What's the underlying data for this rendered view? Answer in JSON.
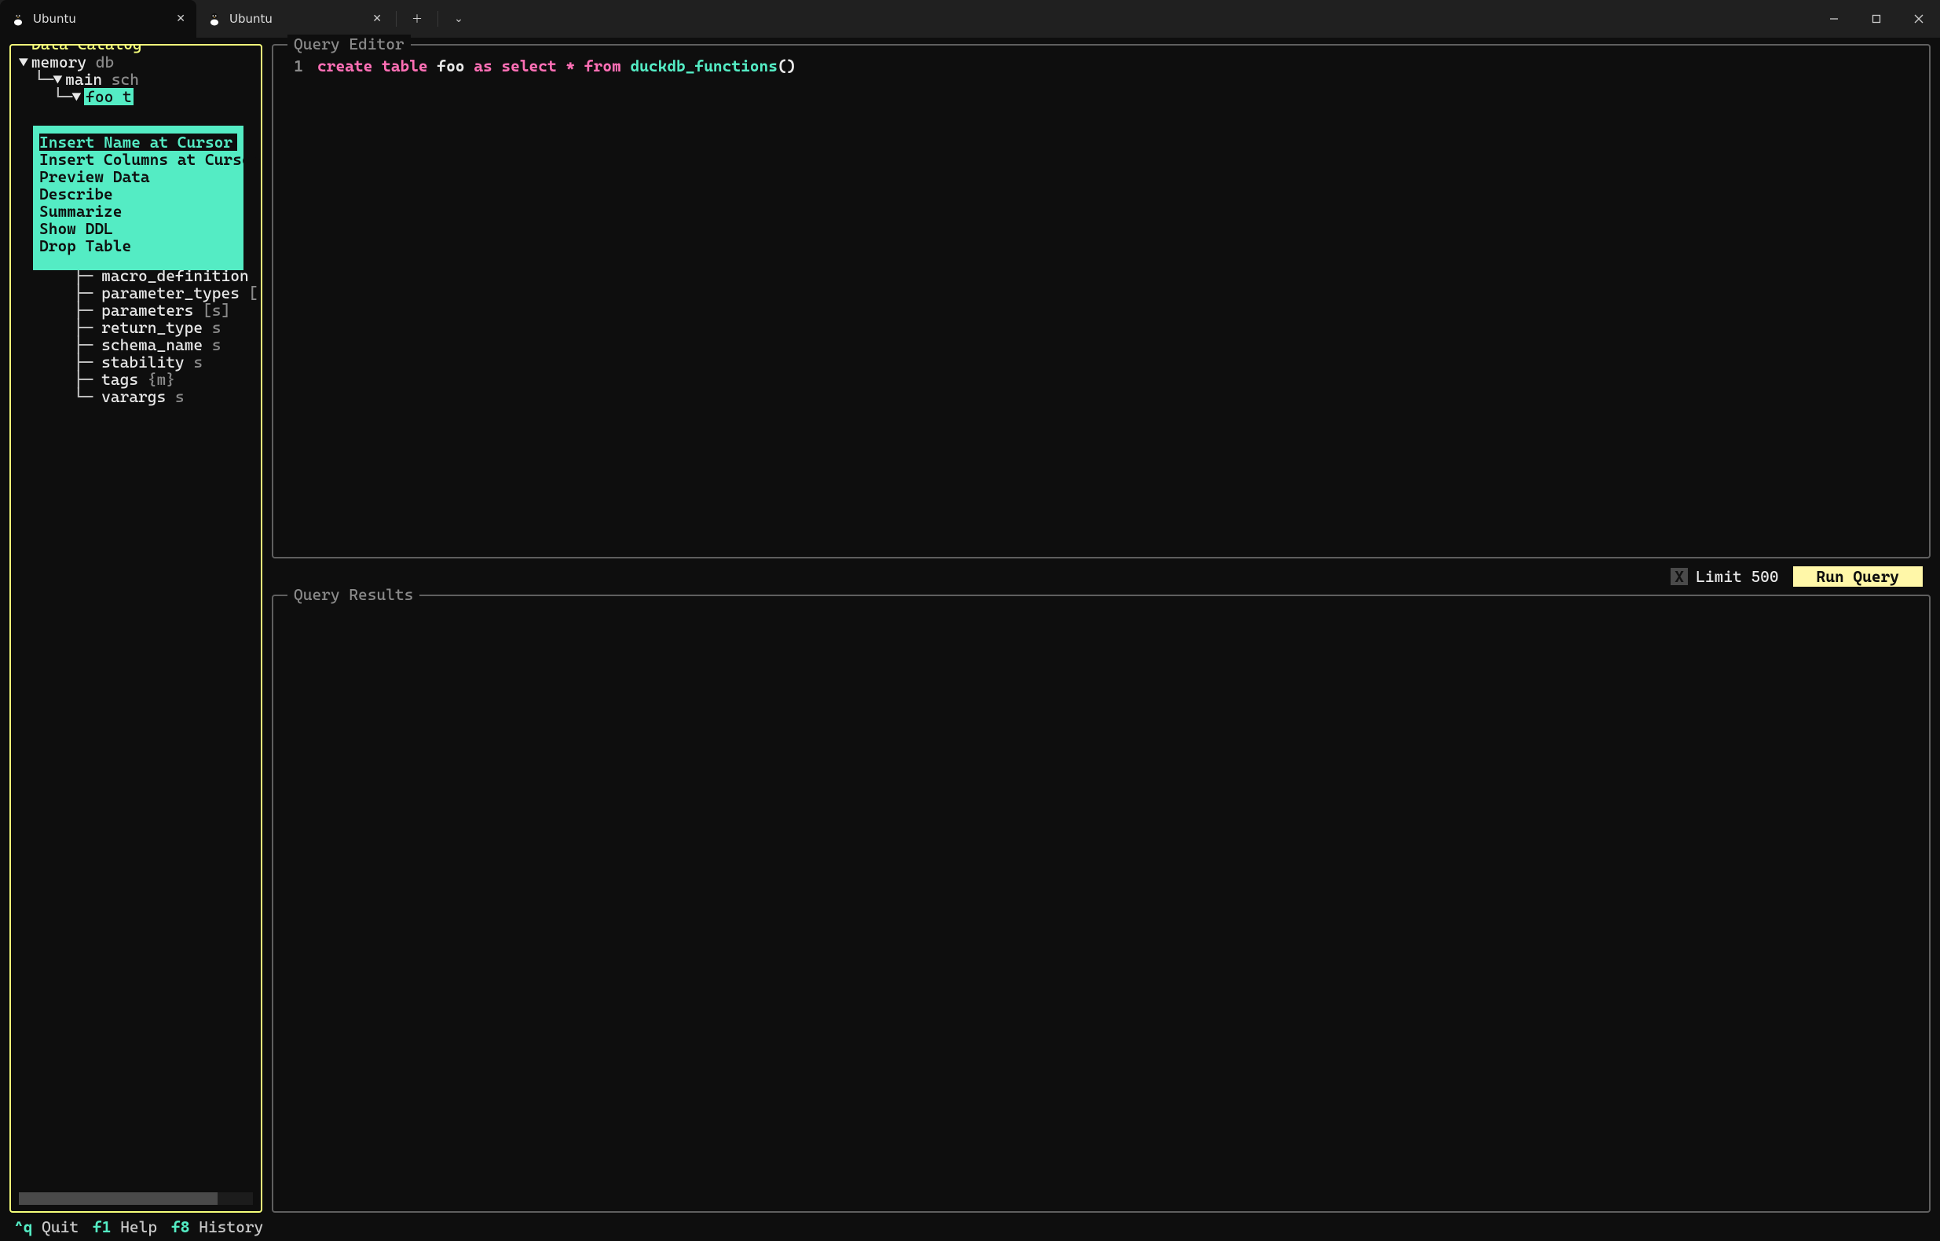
{
  "titlebar": {
    "tabs": [
      {
        "label": "Ubuntu",
        "active": true
      },
      {
        "label": "Ubuntu",
        "active": false
      }
    ]
  },
  "catalog": {
    "title": "Data Catalog",
    "db": {
      "name": "memory",
      "type": "db"
    },
    "schema": {
      "name": "main",
      "type": "sch"
    },
    "table": {
      "name": "foo",
      "type": "t"
    },
    "columns": [
      {
        "name": "macro_definition",
        "type": ""
      },
      {
        "name": "parameter_types",
        "type": "["
      },
      {
        "name": "parameters",
        "type": "[s]"
      },
      {
        "name": "return_type",
        "type": "s"
      },
      {
        "name": "schema_name",
        "type": "s"
      },
      {
        "name": "stability",
        "type": "s"
      },
      {
        "name": "tags",
        "type": "{m}"
      },
      {
        "name": "varargs",
        "type": "s"
      }
    ]
  },
  "context_menu": {
    "items": [
      "Insert Name at Cursor",
      "Insert Columns at Cursor",
      "Preview Data",
      "Describe",
      "Summarize",
      "Show DDL",
      "Drop Table"
    ],
    "selected_index": 0
  },
  "editor": {
    "title": "Query Editor",
    "line_no": "1",
    "tokens": {
      "create": "create",
      "table": "table",
      "foo": "foo",
      "as": "as",
      "select": "select",
      "star": "*",
      "from": "from",
      "fn": "duckdb_functions",
      "parens": "()"
    }
  },
  "toolbar": {
    "limit_checked": "X",
    "limit_label": "Limit 500",
    "run_label": "Run Query"
  },
  "results": {
    "title": "Query Results"
  },
  "footer": {
    "quit_key": "^q",
    "quit_label": "Quit",
    "help_key": "f1",
    "help_label": "Help",
    "history_key": "f8",
    "history_label": "History"
  }
}
